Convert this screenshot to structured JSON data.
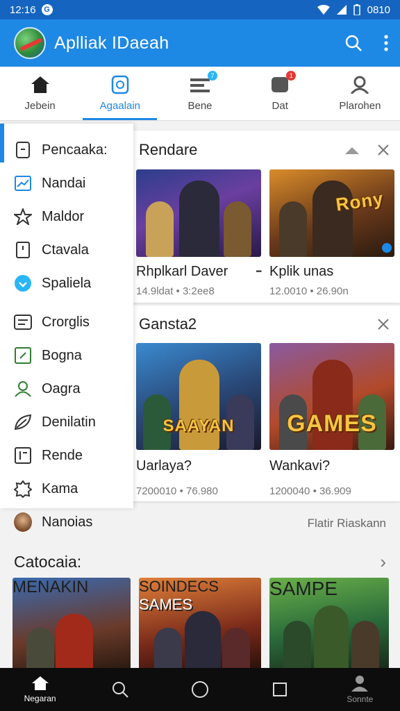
{
  "status": {
    "time": "12:16",
    "right_text": "0810"
  },
  "app": {
    "title": "Aplliak IDaeah"
  },
  "tabs": [
    {
      "label": "Jebein",
      "icon": "home-icon"
    },
    {
      "label": "Agaalain",
      "icon": "game-icon"
    },
    {
      "label": "Bene",
      "icon": "list-icon",
      "badge": "7"
    },
    {
      "label": "Dat",
      "icon": "chat-icon",
      "badge": "1"
    },
    {
      "label": "Plarohen",
      "icon": "profile-icon"
    }
  ],
  "drawer": {
    "items": [
      {
        "label": "Pencaaka:",
        "icon": "page-icon"
      },
      {
        "label": "Nandai",
        "icon": "chart-icon"
      },
      {
        "label": "Maldor",
        "icon": "star-icon"
      },
      {
        "label": "Ctavala",
        "icon": "doc-icon"
      },
      {
        "label": "Spaliela",
        "icon": "circle-icon"
      },
      {
        "label": "Crorglis",
        "icon": "card-icon"
      },
      {
        "label": "Bogna",
        "icon": "edit-icon"
      },
      {
        "label": "Oagra",
        "icon": "people-icon"
      },
      {
        "label": "Denilatin",
        "icon": "leaf-icon"
      },
      {
        "label": "Rende",
        "icon": "calendar-icon"
      },
      {
        "label": "Kama",
        "icon": "badge-icon"
      },
      {
        "label": "Nanoias",
        "icon": "avatar-icon"
      }
    ]
  },
  "sections": [
    {
      "title": "Rendare",
      "games": [
        {
          "title": "Rhplkarl Daver",
          "meta": "14.9ldat • 3:2ee8",
          "more": "•••"
        },
        {
          "title": "Kplik unas",
          "meta": "12.0010 • 26.90n",
          "cover_text": "Rony"
        }
      ]
    },
    {
      "title": "Gansta2",
      "games": [
        {
          "title": "Uarlaya?",
          "meta": "7200010 • 76.980",
          "cover_text": "SAAYAN"
        },
        {
          "title": "Wankavi?",
          "meta": "1200040 • 36.909",
          "cover_text": "GAMES"
        }
      ]
    }
  ],
  "featured_link": "Flatir Riaskann",
  "categories": {
    "title": "Catocaia:",
    "covers": [
      "MENAKIN",
      "SOINDECS",
      "SAMPE"
    ],
    "cover_sub": [
      "",
      "SAMES",
      ""
    ]
  },
  "nav": [
    {
      "label": "Negaran",
      "icon": "home-icon"
    },
    {
      "label": "",
      "icon": "search-icon"
    },
    {
      "label": "",
      "icon": "circle-icon"
    },
    {
      "label": "",
      "icon": "square-icon"
    },
    {
      "label": "Sonnte",
      "icon": "person-icon"
    }
  ]
}
